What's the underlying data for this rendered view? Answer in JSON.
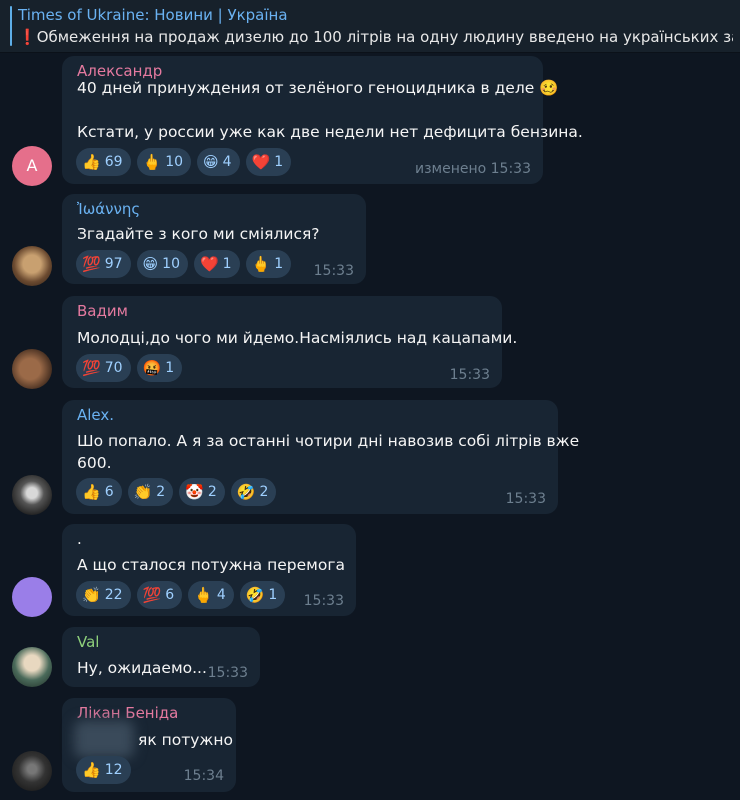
{
  "pinned": {
    "title": "Times of Ukraine: Новини | Україна",
    "icon": "exclamation-mark",
    "text": "Обмеження на продаж дизелю до 100 літрів на одну людину введено на українських запр..."
  },
  "messages": [
    {
      "name": "Александр",
      "name_color": "#e57aa0",
      "avatar_letter": "A",
      "lines": [
        "40 дней принуждения от зелёного геноцидника в деле 🥴",
        "",
        "Кстати, у россии уже как две недели нет дефицита бензина."
      ],
      "reactions": [
        {
          "emoji": "👍",
          "count": "69"
        },
        {
          "emoji": "🖕",
          "count": "10"
        },
        {
          "emoji": "😁",
          "count": "4"
        },
        {
          "emoji": "❤️",
          "count": "1"
        }
      ],
      "time": "изменено 15:33"
    },
    {
      "name": "Ἰωάννης",
      "name_color": "#6ab2f2",
      "lines": [
        "Згадайте з кого ми сміялися?"
      ],
      "reactions": [
        {
          "emoji": "💯",
          "count": "97"
        },
        {
          "emoji": "😁",
          "count": "10"
        },
        {
          "emoji": "❤️",
          "count": "1"
        },
        {
          "emoji": "🖕",
          "count": "1"
        }
      ],
      "time": "15:33"
    },
    {
      "name": "Вадим",
      "name_color": "#e57aa0",
      "lines": [
        "Молодці,до чого ми йдемо.Насміялись над кацапами."
      ],
      "reactions": [
        {
          "emoji": "💯",
          "count": "70"
        },
        {
          "emoji": "🤬",
          "count": "1"
        }
      ],
      "time": "15:33"
    },
    {
      "name": "Alex.",
      "name_color": "#6ab2f2",
      "lines": [
        "Шо попало. А я за останні чотири дні навозив собі літрів вже",
        "600."
      ],
      "reactions": [
        {
          "emoji": "👍",
          "count": "6"
        },
        {
          "emoji": "👏",
          "count": "2"
        },
        {
          "emoji": "🤡",
          "count": "2"
        },
        {
          "emoji": "🤣",
          "count": "2"
        }
      ],
      "time": "15:33"
    },
    {
      "name": ".",
      "name_color": "#f5f5f5",
      "lines": [
        "А що сталося потужна перемога"
      ],
      "reactions": [
        {
          "emoji": "👏",
          "count": "22"
        },
        {
          "emoji": "💯",
          "count": "6"
        },
        {
          "emoji": "🖕",
          "count": "4"
        },
        {
          "emoji": "🤣",
          "count": "1"
        }
      ],
      "time": "15:33"
    },
    {
      "name": "Val",
      "name_color": "#8ed07b",
      "lines": [
        "Ну, ожидаемо..."
      ],
      "reactions": [],
      "time": "15:33"
    },
    {
      "name": "Лікан Беніда",
      "name_color": "#e57aa0",
      "lines": [
        "як потужно"
      ],
      "reactions": [
        {
          "emoji": "👍",
          "count": "12"
        }
      ],
      "time": "15:34"
    }
  ]
}
